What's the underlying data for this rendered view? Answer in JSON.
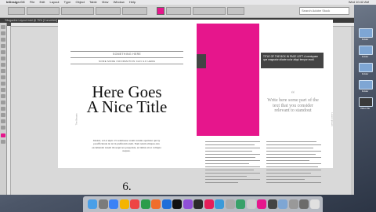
{
  "menubar": {
    "items": [
      "InDesign CC",
      "File",
      "Edit",
      "Layout",
      "Type",
      "Object",
      "Table",
      "View",
      "Window",
      "Help"
    ],
    "clock": "Wed 10:42 AM"
  },
  "app": {
    "search_placeholder": "Search Adobe Stock",
    "zoom": "75%",
    "doc_tab": "*Magazine Layout.indd @ 75% [Converted]",
    "accent": "#e6168c"
  },
  "left_page": {
    "subtitle_1": "SOMETHING HERE",
    "subtitle_2": "SOME MORE INFORMATION CAN GO HERE",
    "title_line1": "Here Goes",
    "title_line2": "A Nice Title",
    "paragraph": "Itisdolr, vel et ulpit. Ut venimouse veum vernnis aperiatur qui by porefficiunde de tat in prefincum atem. Nam rerum alitquas eles eacumendat ionem im sequi nos prepedate, ad nimus sit et vollupta neques.",
    "page_number": "6.",
    "margin_left": "The Beasts"
  },
  "right_page": {
    "box_text": "TITLE OF THE BOX IN PAGE LEFT. A nemiquam que magnatur alicate solur aliqui tempor modi.",
    "quote": "Write here some part of the text that you consider relevant to standout",
    "quote_mark": "“",
    "margin_right": "Lorem Ipsum"
  },
  "dock": {
    "colors": [
      "#4a9fe8",
      "#7b7b7b",
      "#3b82f6",
      "#f4b400",
      "#e44",
      "#2b9c4a",
      "#f06d2b",
      "#1e6fd9",
      "#111",
      "#8f4fd6",
      "#2b2b2b",
      "#e61e59",
      "#3a9ad9",
      "#aaa",
      "#38a169",
      "#ccc",
      "#e6168c",
      "#444",
      "#7ea6d4",
      "#999",
      "#6b6b6b",
      "#e0e0e0"
    ]
  },
  "desktop": {
    "icons": [
      "Folder",
      "Folder",
      "Folder",
      "Folder",
      "Video file"
    ]
  }
}
